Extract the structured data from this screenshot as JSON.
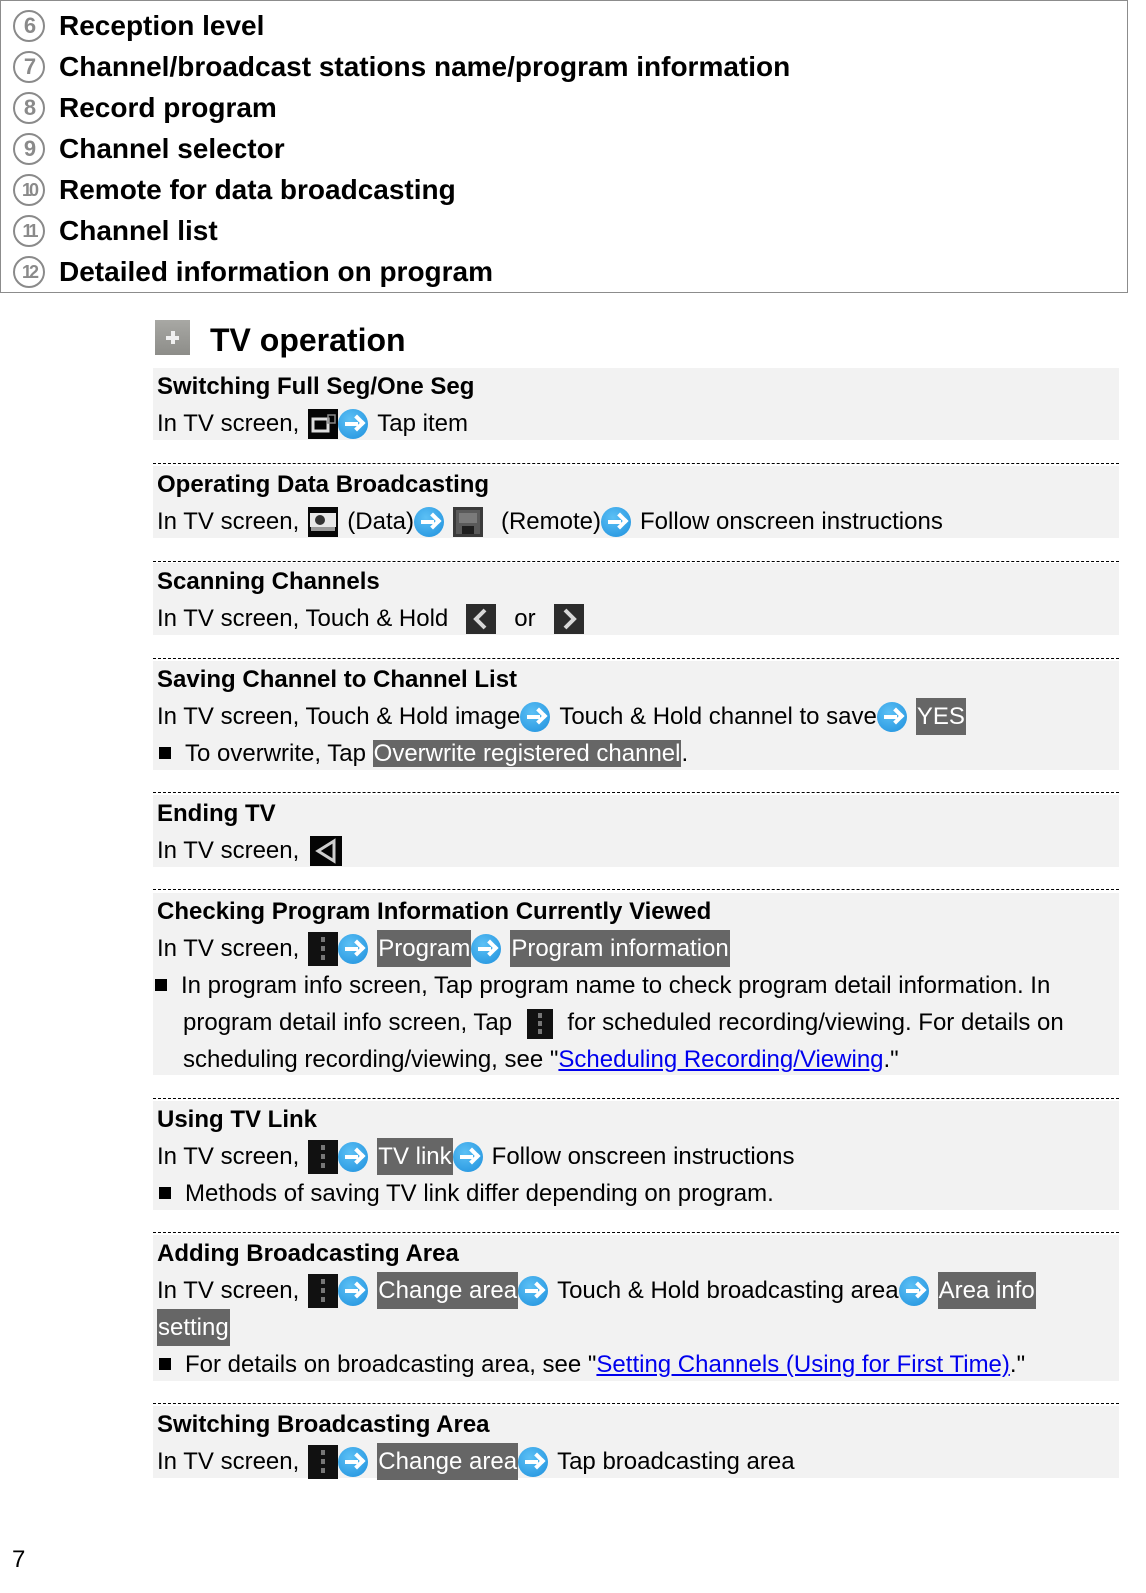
{
  "legend": {
    "items": [
      {
        "num": "6",
        "label": "Reception level"
      },
      {
        "num": "7",
        "label": "Channel/broadcast stations name/program information"
      },
      {
        "num": "8",
        "label": "Record program"
      },
      {
        "num": "9",
        "label": "Channel selector"
      },
      {
        "num": "10",
        "label": "Remote for data broadcasting"
      },
      {
        "num": "11",
        "label": "Channel list"
      },
      {
        "num": "12",
        "label": "Detailed information on program"
      }
    ]
  },
  "section": {
    "icon": "plus-icon",
    "title": "TV operation"
  },
  "operations": [
    {
      "title": "Switching Full Seg/One Seg",
      "line": {
        "prefix": "In TV screen,",
        "suffix": "Tap item"
      }
    },
    {
      "title": "Operating Data Broadcasting",
      "line": {
        "prefix": "In TV screen,",
        "data_label": "(Data)",
        "remote_label": "(Remote)",
        "suffix": "Follow onscreen instructions"
      }
    },
    {
      "title": "Scanning Channels",
      "line": {
        "prefix": "In TV screen, Touch & Hold",
        "or": "or"
      }
    },
    {
      "title": "Saving Channel to Channel List",
      "line": {
        "prefix": "In TV screen, Touch & Hold image",
        "middle": "Touch & Hold channel to save",
        "key": "YES"
      },
      "note": {
        "prefix": "To overwrite, Tap",
        "key": "Overwrite registered channel",
        "suffix": "."
      }
    },
    {
      "title": "Ending TV",
      "line": {
        "prefix": "In TV screen,"
      }
    },
    {
      "title": "Checking Program Information Currently Viewed",
      "line": {
        "prefix": "In TV screen,",
        "key1": "Program",
        "key2": "Program information"
      },
      "note": {
        "part1": "In program info screen, Tap program name to check program detail information. In",
        "part2": "program detail info screen, Tap",
        "part3": "for scheduled recording/viewing. For details on",
        "part4": "scheduling recording/viewing, see \"",
        "link": "Scheduling Recording/Viewing",
        "part5": ".\""
      }
    },
    {
      "title": "Using TV Link",
      "line": {
        "prefix": "In TV screen,",
        "key": "TV link",
        "suffix": "Follow onscreen instructions"
      },
      "note": {
        "text": "Methods of saving TV link differ depending on program."
      }
    },
    {
      "title": "Adding Broadcasting Area",
      "line": {
        "prefix": "In TV screen,",
        "key1": "Change area",
        "middle": "Touch & Hold broadcasting area",
        "key2a": "Area info",
        "key2b": "setting"
      },
      "note": {
        "prefix": "For details on broadcasting area, see \"",
        "link": "Setting Channels (Using for First Time)",
        "suffix": ".\""
      }
    },
    {
      "title": "Switching Broadcasting Area",
      "line": {
        "prefix": "In TV screen,",
        "key": "Change area",
        "suffix": "Tap broadcasting area"
      }
    }
  ],
  "page_number": "7"
}
